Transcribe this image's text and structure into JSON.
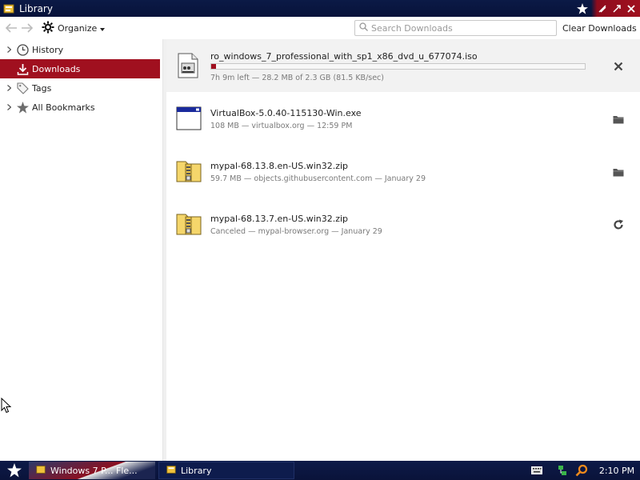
{
  "window": {
    "title": "Library"
  },
  "toolbar": {
    "organize_label": "Organize",
    "search_placeholder": "Search Downloads",
    "clear_label": "Clear Downloads"
  },
  "sidebar": {
    "items": [
      {
        "label": "History",
        "icon": "clock-icon",
        "selected": false
      },
      {
        "label": "Downloads",
        "icon": "download-icon",
        "selected": true
      },
      {
        "label": "Tags",
        "icon": "tag-icon",
        "selected": false
      },
      {
        "label": "All Bookmarks",
        "icon": "star-icon",
        "selected": false
      }
    ]
  },
  "downloads": [
    {
      "name": "ro_windows_7_professional_with_sp1_x86_dvd_u_677074.iso",
      "status": "7h 9m left — 28.2 MB of 2.3 GB (81.5 KB/sec)",
      "progress_fraction": 0.012,
      "icon": "disc-image-file-icon",
      "action": "cancel-icon"
    },
    {
      "name": "VirtualBox-5.0.40-115130-Win.exe",
      "status": "108 MB — virtualbox.org — 12:59 PM",
      "icon": "executable-file-icon",
      "action": "folder-icon"
    },
    {
      "name": "mypal-68.13.8.en-US.win32.zip",
      "status": "59.7 MB — objects.githubusercontent.com — January 29",
      "icon": "zip-file-icon",
      "action": "folder-icon"
    },
    {
      "name": "mypal-68.13.7.en-US.win32.zip",
      "status": "Canceled — mypal-browser.org — January 29",
      "icon": "zip-file-icon",
      "action": "retry-icon"
    }
  ],
  "taskbar": {
    "tasks": [
      {
        "label": "Windows 7 P... Fle..."
      },
      {
        "label": "Library"
      }
    ],
    "clock": "2:10 PM"
  },
  "colors": {
    "accent": "#a0101f",
    "titlebar": "#0b1a46"
  }
}
